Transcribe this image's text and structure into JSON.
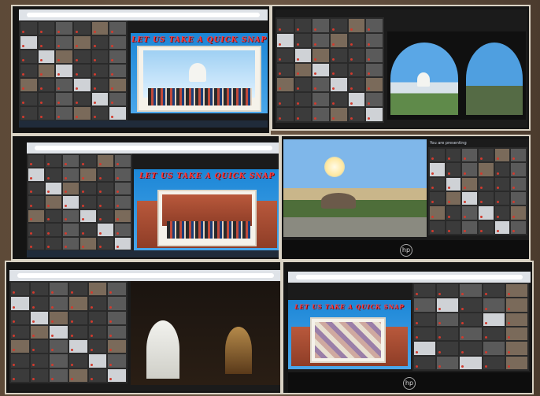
{
  "collage": {
    "photos": [
      {
        "slide_title": "LET US TAKE A QUICK SNAP"
      },
      {
        "slide_title": ""
      },
      {
        "slide_title": "LET US TAKE A QUICK SNAP"
      },
      {
        "slide_title": ""
      },
      {
        "slide_title": ""
      },
      {
        "slide_title": "LET US TAKE A QUICK SNAP"
      }
    ]
  },
  "laptop_brand": "hp",
  "presenting_label": "You are presenting"
}
